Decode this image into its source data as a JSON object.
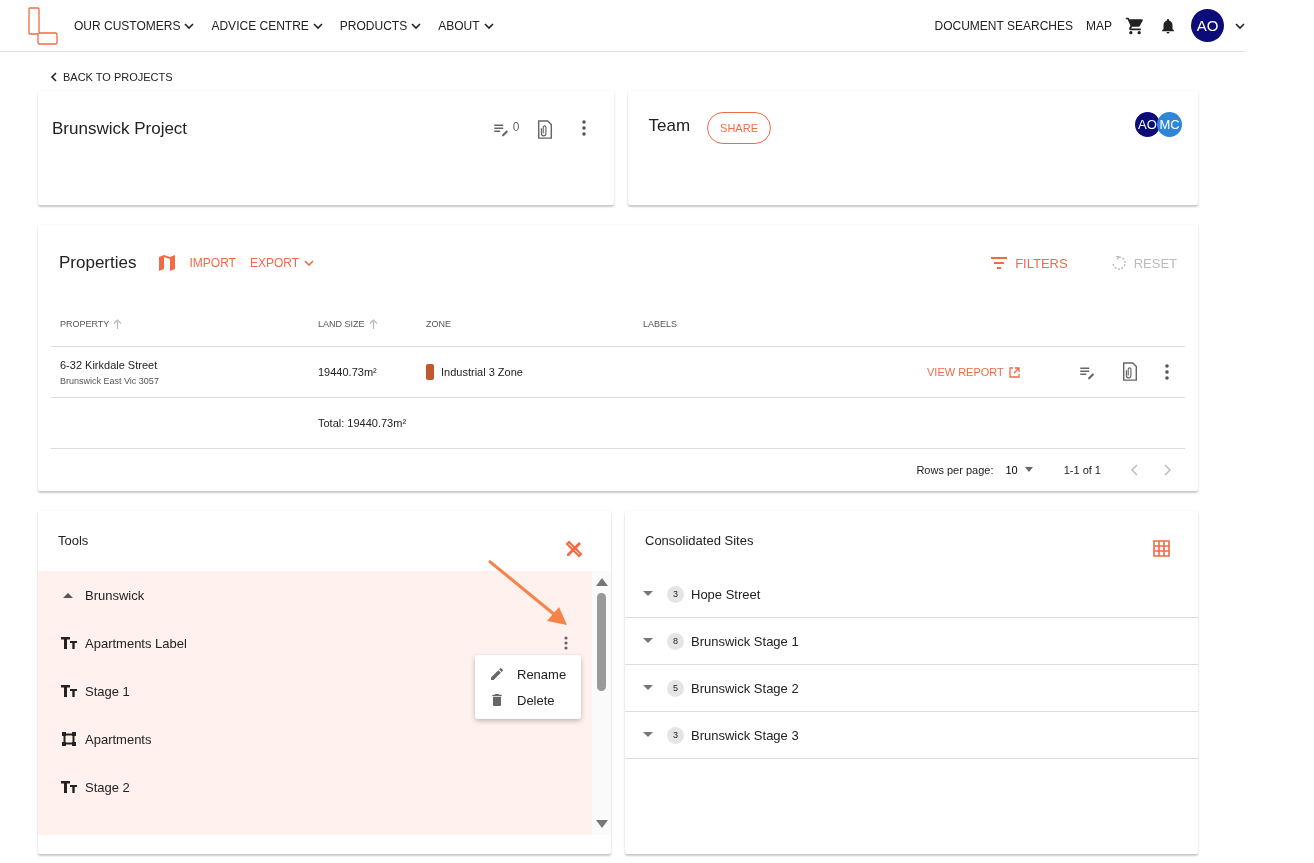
{
  "nav": {
    "menus": [
      {
        "label": "OUR CUSTOMERS"
      },
      {
        "label": "ADVICE CENTRE"
      },
      {
        "label": "PRODUCTS"
      },
      {
        "label": "ABOUT"
      }
    ],
    "links": [
      "DOCUMENT SEARCHES",
      "MAP"
    ],
    "avatar": "AO"
  },
  "back_link": "BACK TO PROJECTS",
  "project": {
    "title": "Brunswick Project",
    "notes_count": "0"
  },
  "team": {
    "title": "Team",
    "share": "SHARE",
    "members": [
      {
        "initials": "AO",
        "color": "#0b0b7a"
      },
      {
        "initials": "MC",
        "color": "#2f86d6"
      }
    ]
  },
  "properties": {
    "title": "Properties",
    "import": "IMPORT",
    "export": "EXPORT",
    "filters": "FILTERS",
    "reset": {
      "label": "RESET",
      "disabled": true
    },
    "columns": [
      {
        "label": "PROPERTY",
        "sortable": true
      },
      {
        "label": "LAND SIZE",
        "sortable": true
      },
      {
        "label": "ZONE",
        "sortable": false
      },
      {
        "label": "LABELS",
        "sortable": false
      }
    ],
    "rows": [
      {
        "address": "6-32 Kirkdale Street",
        "suburb": "Brunswick East Vic 3057",
        "land_size": "19440.73m²",
        "zone": {
          "name": "Industrial 3 Zone",
          "color": "#c0582b"
        },
        "action": "VIEW REPORT"
      }
    ],
    "total": "Total: 19440.73m²",
    "rows_per_page_label": "Rows per page:",
    "rows_per_page": "10",
    "range": "1-1 of 1"
  },
  "tools": {
    "title": "Tools",
    "groups": [
      {
        "name": "Brunswick",
        "expanded": true,
        "children": [
          {
            "kind": "text",
            "name": "Apartments Label",
            "menu_open": true
          },
          {
            "kind": "text",
            "name": "Stage 1",
            "menu_open": false
          },
          {
            "kind": "polygon",
            "name": "Apartments",
            "menu_open": false
          },
          {
            "kind": "text",
            "name": "Stage 2",
            "menu_open": false
          }
        ]
      }
    ],
    "menu": [
      {
        "kind": "rename",
        "label": "Rename"
      },
      {
        "kind": "delete",
        "label": "Delete"
      }
    ]
  },
  "consolidated": {
    "title": "Consolidated Sites",
    "sites": [
      {
        "count": "3",
        "name": "Hope Street",
        "expanded": false
      },
      {
        "count": "8",
        "name": "Brunswick Stage 1",
        "expanded": false
      },
      {
        "count": "5",
        "name": "Brunswick Stage 2",
        "expanded": false
      },
      {
        "count": "3",
        "name": "Brunswick Stage 3",
        "expanded": false
      }
    ]
  }
}
